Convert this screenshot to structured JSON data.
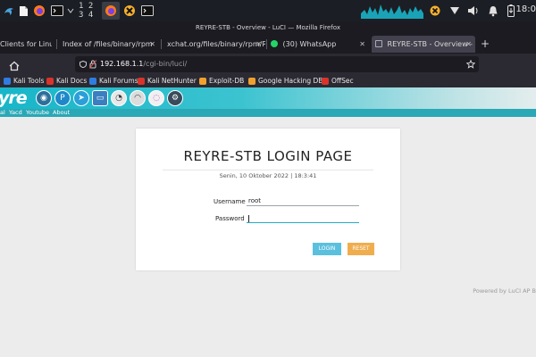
{
  "taskbar": {
    "workspaces": "1 2 3 4",
    "clock": "18:0"
  },
  "window": {
    "title": "REYRE-STB - Overview - LuCI — Mozilla Firefox"
  },
  "tabs": [
    {
      "label": "Clients for Linu"
    },
    {
      "label": "Index of /files/binary/rpm"
    },
    {
      "label": "xchat.org/files/binary/rpm/R"
    },
    {
      "label": "(30) WhatsApp"
    },
    {
      "label": "REYRE-STB - Overview - L"
    }
  ],
  "navbar": {
    "url_host": "192.168.1.1",
    "url_path": "/cgi-bin/luci/"
  },
  "bookmarks": [
    {
      "label": "Kali Tools",
      "color": "#2f7de1"
    },
    {
      "label": "Kali Docs",
      "color": "#d9342b"
    },
    {
      "label": "Kali Forums",
      "color": "#2f7de1"
    },
    {
      "label": "Kali NetHunter",
      "color": "#d9342b"
    },
    {
      "label": "Exploit-DB",
      "color": "#f0a030"
    },
    {
      "label": "Google Hacking DB",
      "color": "#f0a030"
    },
    {
      "label": "OffSec",
      "color": "#d9342b"
    }
  ],
  "header": {
    "logo": "yre",
    "menu": [
      "al",
      "Yacd",
      "Youtube",
      "About"
    ]
  },
  "login": {
    "title": "REYRE-STB LOGIN PAGE",
    "date": "Senin, 10 Oktober 2022 | 18:3:41",
    "username_label": "Username",
    "username_value": "root",
    "password_label": "Password",
    "login_button": "LOGIN",
    "reset_button": "RESET"
  },
  "footer": {
    "powered": "Powered by LuCI AP B"
  },
  "colors": {
    "accent": "#2aa8b6",
    "login_button": "#5bc0de",
    "reset_button": "#f0ad4e"
  }
}
